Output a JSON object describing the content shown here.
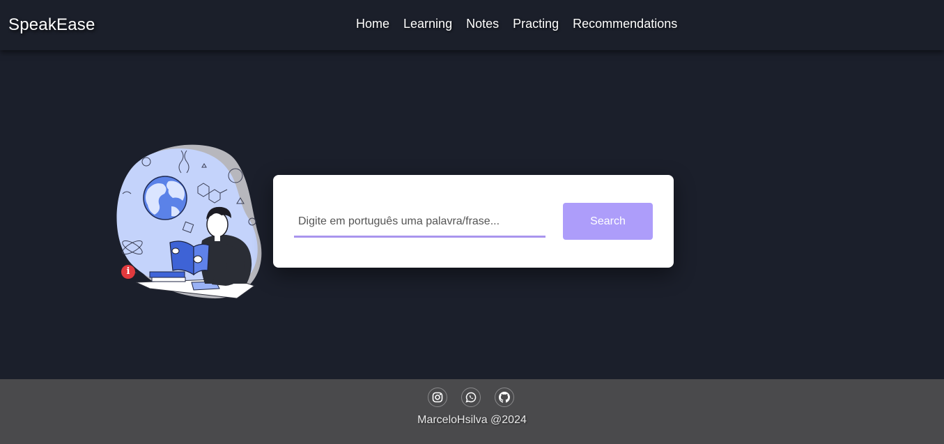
{
  "header": {
    "brand": "SpeakEase",
    "nav": [
      {
        "label": "Home"
      },
      {
        "label": "Learning"
      },
      {
        "label": "Notes"
      },
      {
        "label": "Practing"
      },
      {
        "label": "Recommendations"
      }
    ]
  },
  "hero": {
    "illustration_icon": "student-reading-globe-illustration",
    "info_icon": "info-icon"
  },
  "search": {
    "placeholder": "Digite em português uma palavra/frase...",
    "value": "",
    "button_label": "Search"
  },
  "footer": {
    "socials": [
      {
        "icon": "instagram-icon"
      },
      {
        "icon": "whatsapp-icon"
      },
      {
        "icon": "github-icon"
      }
    ],
    "copyright": "MarceloHsilva @2024"
  },
  "colors": {
    "background": "#1b1f2b",
    "footer": "#4a4a4c",
    "accent": "#ad9dfa",
    "underline": "#a995ee"
  }
}
